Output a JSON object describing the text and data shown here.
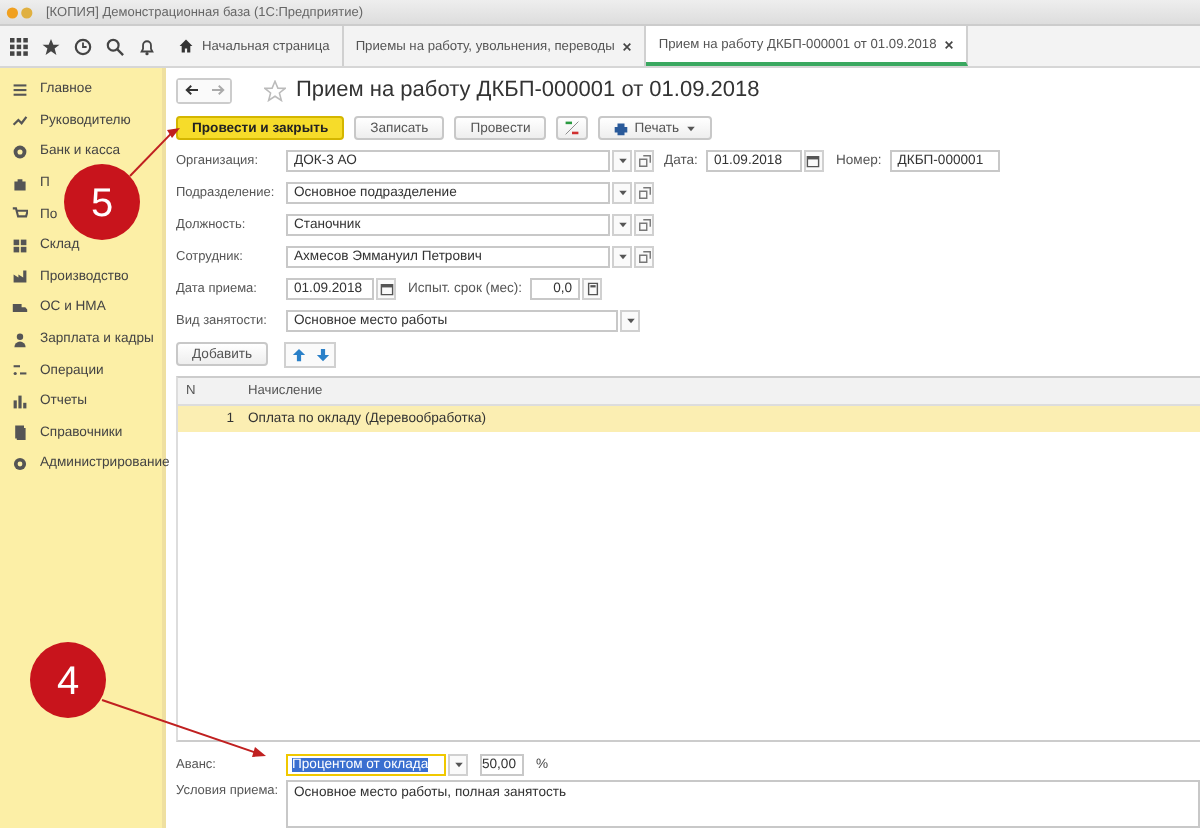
{
  "window": {
    "title": "[КОПИЯ] Демонстрационная база  (1С:Предприятие)"
  },
  "sidebar": {
    "items": [
      {
        "label": "Главное"
      },
      {
        "label": "Руководителю"
      },
      {
        "label": "Банк и касса"
      },
      {
        "label": "П"
      },
      {
        "label": "По"
      },
      {
        "label": "Склад"
      },
      {
        "label": "Производство"
      },
      {
        "label": "ОС и НМА"
      },
      {
        "label": "Зарплата и кадры"
      },
      {
        "label": "Операции"
      },
      {
        "label": "Отчеты"
      },
      {
        "label": "Справочники"
      },
      {
        "label": "Администрирование"
      }
    ]
  },
  "tabs": [
    {
      "kind": "home",
      "label": "Начальная страница",
      "selected": false,
      "closable": false
    },
    {
      "kind": "plain",
      "label": "Приемы на работу, увольнения, переводы",
      "selected": false,
      "closable": true
    },
    {
      "kind": "plain",
      "label": "Прием на работу ДКБП-000001 от 01.09.2018",
      "selected": true,
      "closable": true
    }
  ],
  "document": {
    "title": "Прием на работу ДКБП-000001 от 01.09.2018",
    "favorite": false
  },
  "commands": [
    {
      "kind": "primary",
      "label": "Провести и закрыть"
    },
    {
      "kind": "button",
      "label": "Записать"
    },
    {
      "kind": "button",
      "label": "Провести"
    },
    {
      "kind": "dtkt"
    },
    {
      "kind": "print",
      "label": "Печать"
    }
  ],
  "organization": {
    "label": "Организация:",
    "value": "ДОК-3 АО"
  },
  "date": {
    "label": "Дата:",
    "value": "01.09.2018"
  },
  "number": {
    "label": "Номер:",
    "value": "ДКБП-000001"
  },
  "refs": [
    {
      "label": "Подразделение:",
      "value": "Основное подразделение"
    },
    {
      "label": "Должность:",
      "value": "Станочник"
    },
    {
      "label": "Сотрудник:",
      "value": "Ахмесов Эммануил Петрович"
    }
  ],
  "hire_date": {
    "label": "Дата приема:",
    "value": "01.09.2018"
  },
  "probation": {
    "label": "Испыт. срок (мес):",
    "value": "0,0"
  },
  "employment_type": {
    "label": "Вид занятости:",
    "value": "Основное место работы"
  },
  "table_toolbar": {
    "add": "Добавить"
  },
  "table": {
    "columns": [
      "N",
      "Начисление"
    ],
    "rows": [
      {
        "n": "1",
        "accrual": "Оплата по окладу (Деревообработка)",
        "selected": true
      }
    ]
  },
  "advance": {
    "label": "Аванс:",
    "method": "Процентом от оклада",
    "focused": true,
    "percent": "50,00",
    "unit": "%"
  },
  "conditions": {
    "label": "Условия приема:",
    "value": "Основное место работы, полная занятость"
  },
  "callouts": [
    {
      "number": "5"
    },
    {
      "number": "4"
    }
  ]
}
